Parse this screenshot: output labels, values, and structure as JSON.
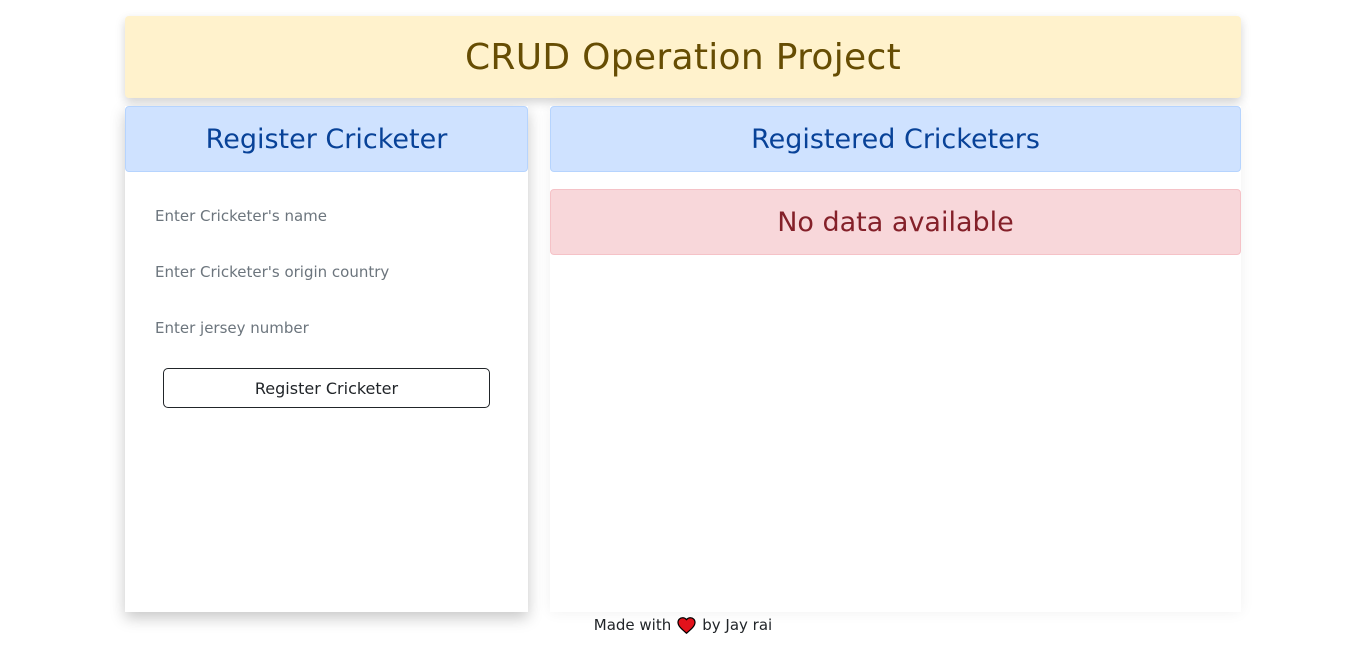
{
  "header": {
    "title": "CRUD Operation Project"
  },
  "register": {
    "title": "Register Cricketer",
    "name_placeholder": "Enter Cricketer's name",
    "country_placeholder": "Enter Cricketer's origin country",
    "jersey_placeholder": "Enter jersey number",
    "submit_label": "Register Cricketer"
  },
  "registered": {
    "title": "Registered Cricketers",
    "empty_message": "No data available"
  },
  "footer": {
    "prefix": "Made with",
    "icon": "heart-icon",
    "suffix": "by Jay rai"
  },
  "colors": {
    "banner_bg": "#fff2cc",
    "banner_text": "#664d03",
    "header_bg": "#cfe2ff",
    "header_text": "#084298",
    "alert_bg": "#f8d7da",
    "alert_text": "#842029",
    "heart": "#e3121b"
  }
}
